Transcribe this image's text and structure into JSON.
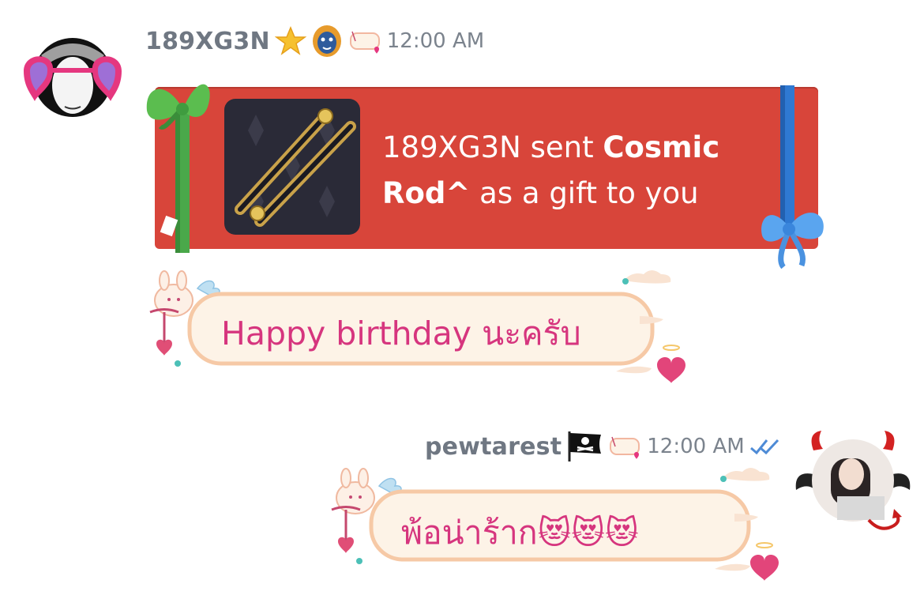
{
  "messages": [
    {
      "username": "189XG3N",
      "time": "12:00 AM",
      "badges": [
        "star-badge",
        "lion-badge",
        "cupid-frame-badge"
      ],
      "gift": {
        "sender": "189XG3N",
        "sent_word": "sent",
        "item": "Cosmic Rod^",
        "suffix": "as a gift to you"
      },
      "text": "Happy birthday นะครับ"
    },
    {
      "username": "pewtarest",
      "time": "12:00 AM",
      "badges": [
        "pirate-flag-badge",
        "cupid-frame-badge"
      ],
      "status": "read-double-check",
      "text": "พ้อน่าร้าก😻😻😻"
    }
  ],
  "colors": {
    "gift_red": "#d8453a",
    "bubble_text": "#d6357e",
    "bubble_fill": "#fdf3e7",
    "bubble_border": "#f6c9a6",
    "check_blue": "#4e8bd6"
  }
}
